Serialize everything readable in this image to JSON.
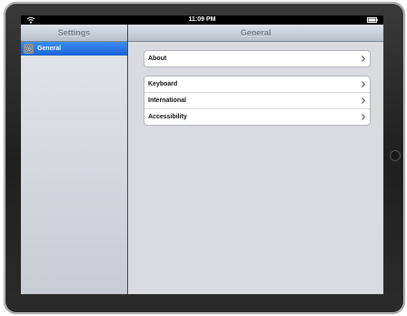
{
  "status_bar": {
    "time": "11:09 PM"
  },
  "sidebar": {
    "title": "Settings",
    "items": [
      {
        "label": "General",
        "icon": "gear-icon",
        "selected": true
      }
    ]
  },
  "detail": {
    "title": "General",
    "groups": [
      {
        "rows": [
          {
            "label": "About"
          }
        ]
      },
      {
        "rows": [
          {
            "label": "Keyboard"
          },
          {
            "label": "International"
          },
          {
            "label": "Accessibility"
          }
        ]
      }
    ]
  },
  "colors": {
    "selection": "#1a62d4",
    "nav_text": "#6d7580",
    "background": "#d9dbe0"
  }
}
